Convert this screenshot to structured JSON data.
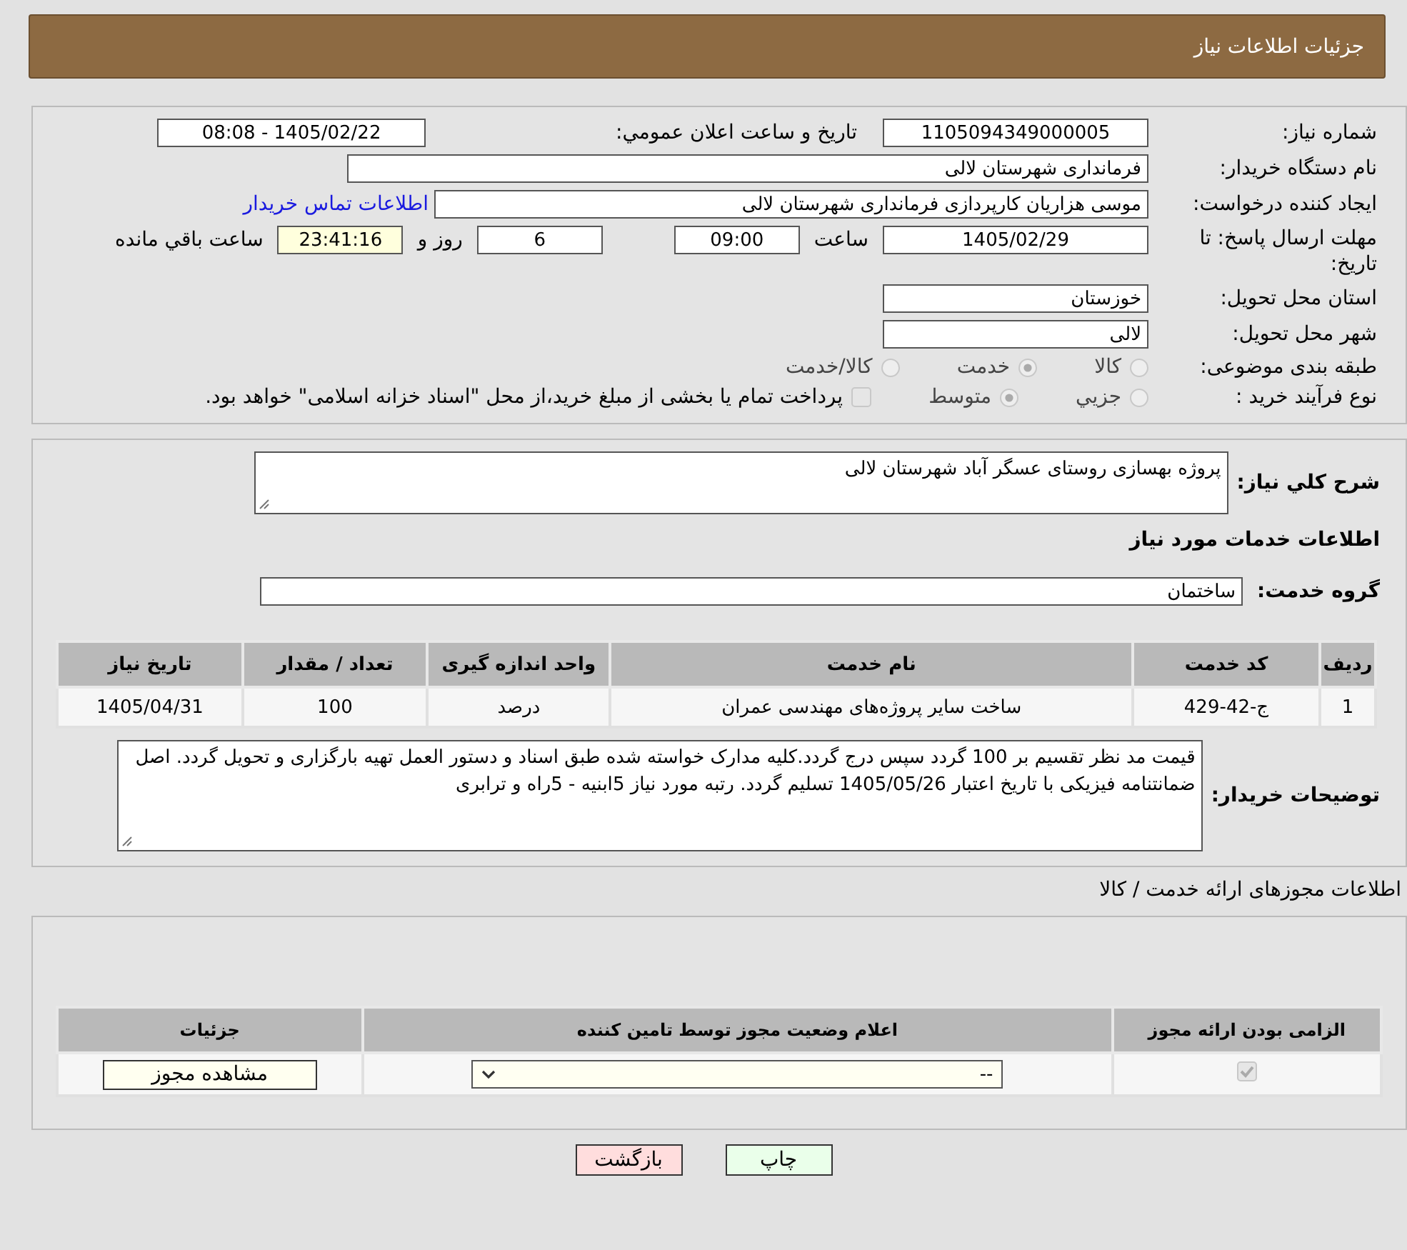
{
  "header": {
    "title": "جزئیات اطلاعات نیاز"
  },
  "info": {
    "need_number": {
      "label": "شماره نیاز:",
      "value": "1105094349000005"
    },
    "announce": {
      "label": "تاریخ و ساعت اعلان عمومي:",
      "value": "1405/02/22 - 08:08"
    },
    "buyer": {
      "label": "نام دستگاه خريدار:",
      "value": "فرمانداری شهرستان لالی"
    },
    "requester": {
      "label": "ايجاد کننده درخواست:",
      "value": "موسی هزاریان کارپردازی فرمانداری شهرستان لالی",
      "link": "اطلاعات تماس خريدار"
    },
    "deadline": {
      "label": "مهلت ارسال پاسخ: تا تاريخ:",
      "date": "1405/02/29",
      "time_label": "ساعت",
      "time": "09:00",
      "days": "6",
      "days_label": "روز و",
      "remaining": "23:41:16",
      "remaining_label": "ساعت باقي مانده"
    },
    "province": {
      "label": "استان محل تحويل:",
      "value": "خوزستان"
    },
    "city": {
      "label": "شهر محل تحويل:",
      "value": "لالی"
    },
    "category": {
      "label": "طبقه بندی موضوعی:",
      "options": [
        {
          "label": "کالا",
          "selected": false
        },
        {
          "label": "خدمت",
          "selected": true
        },
        {
          "label": "کالا/خدمت",
          "selected": false
        }
      ]
    },
    "process": {
      "label": "نوع فرآیند خرید :",
      "options": [
        {
          "label": "جزيي",
          "selected": false
        },
        {
          "label": "متوسط",
          "selected": true
        }
      ],
      "treasury": {
        "checked": false,
        "text": "پرداخت تمام یا بخشی از مبلغ خرید،از محل \"اسناد خزانه اسلامی\" خواهد بود."
      }
    }
  },
  "services": {
    "summary": {
      "label": "شرح کلي نياز:",
      "value": "پروژه بهسازی روستای عسگر آباد شهرستان لالی"
    },
    "section_title": "اطلاعات خدمات مورد نياز",
    "group": {
      "label": "گروه خدمت:",
      "value": "ساختمان"
    },
    "table": {
      "columns": [
        "رديف",
        "کد خدمت",
        "نام خدمت",
        "واحد اندازه گیری",
        "تعداد / مقدار",
        "تاریخ نیاز"
      ],
      "rows": [
        [
          "1",
          "ج-42-429",
          "ساخت سایر پروژه‌های مهندسی عمران",
          "درصد",
          "100",
          "1405/04/31"
        ]
      ]
    },
    "notes": {
      "label": "توضيحات خريدار:",
      "value": "قیمت مد نظر تقسیم بر 100 گردد سپس درج گردد.کلیه مدارک خواسته شده طبق اسناد و دستور العمل  تهیه  بارگزاری و تحویل گردد. اصل ضمانتنامه فیزیکی با تاریخ اعتبار 1405/05/26 تسلیم گردد. رتبه مورد نیاز 5ابنیه - 5راه و ترابری"
    }
  },
  "permits": {
    "title": "اطلاعات مجوزهای ارائه خدمت / کالا",
    "columns": [
      "الزامی بودن ارائه مجوز",
      "اعلام وضعیت مجوز توسط تامین کننده",
      "جزئیات"
    ],
    "rows": [
      {
        "required": true,
        "status": "--",
        "button": "مشاهده مجوز"
      }
    ]
  },
  "actions": [
    {
      "kind": "print",
      "label": "چاپ"
    },
    {
      "kind": "back",
      "label": "بازگشت"
    }
  ]
}
